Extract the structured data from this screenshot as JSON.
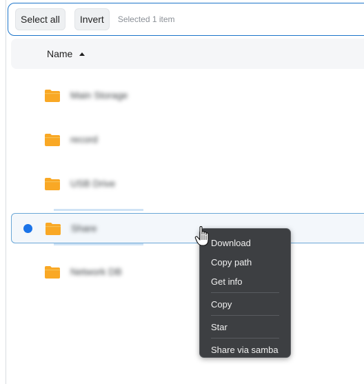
{
  "toolbar": {
    "select_all_label": "Select all",
    "invert_label": "Invert",
    "status_text": "Selected 1 item"
  },
  "list": {
    "column_name": "Name",
    "sort": "ascending",
    "rows": [
      {
        "name": "Main Storage",
        "selected": false
      },
      {
        "name": "record",
        "selected": false
      },
      {
        "name": "USB Drive",
        "selected": false
      },
      {
        "name": "Share",
        "selected": true
      },
      {
        "name": "Network DB",
        "selected": false
      }
    ]
  },
  "context_menu": {
    "items": [
      "Download",
      "Copy path",
      "Get info",
      "Copy",
      "Star",
      "Share via samba"
    ]
  },
  "colors": {
    "accent": "#1a73e8",
    "folder": "#f9a825",
    "menu_bg": "#3d3f42"
  }
}
